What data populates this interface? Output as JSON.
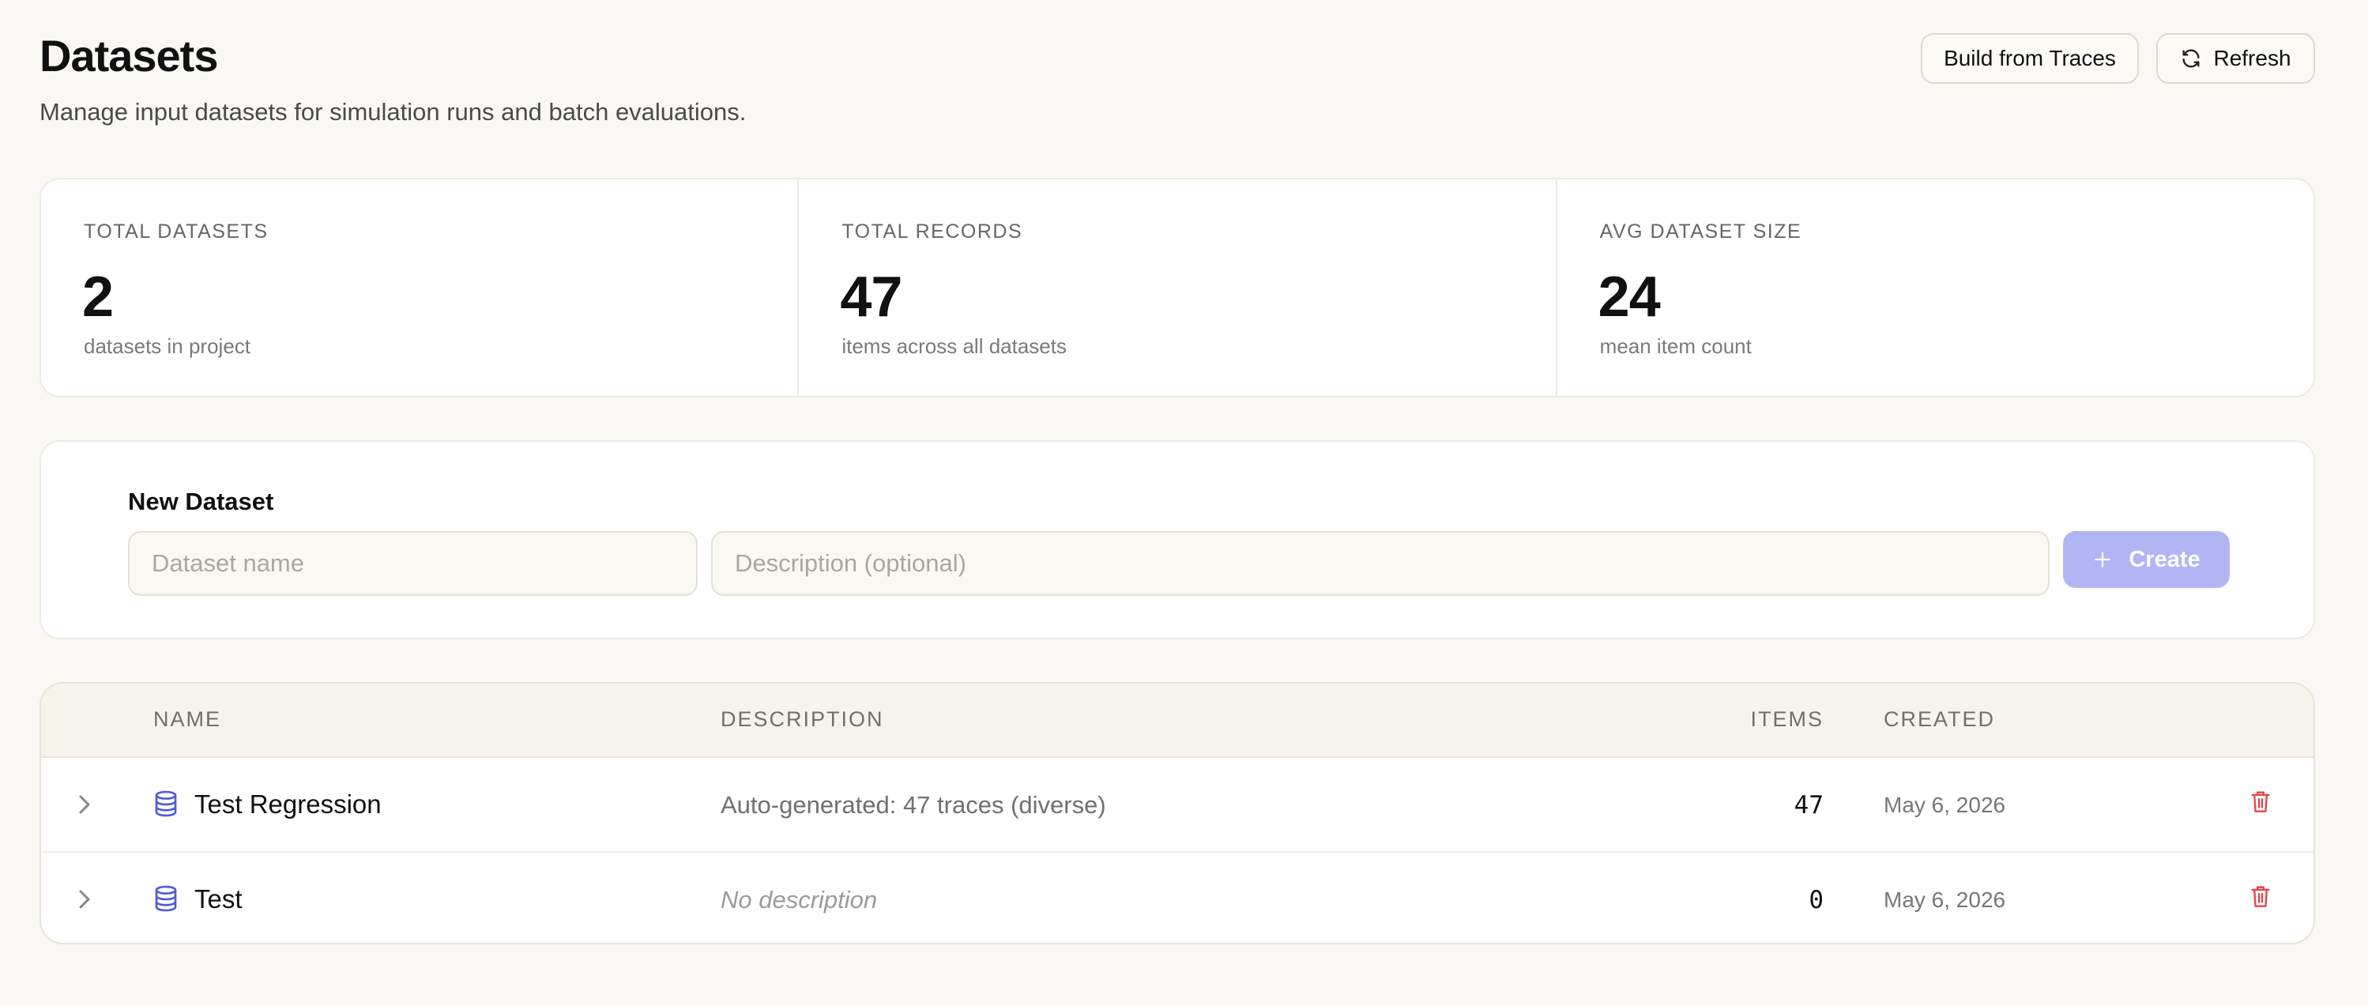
{
  "header": {
    "title": "Datasets",
    "subtitle": "Manage input datasets for simulation runs and batch evaluations.",
    "build_button": "Build from Traces",
    "refresh_button": "Refresh"
  },
  "stats": [
    {
      "label": "TOTAL DATASETS",
      "value": "2",
      "caption": "datasets in project"
    },
    {
      "label": "TOTAL RECORDS",
      "value": "47",
      "caption": "items across all datasets"
    },
    {
      "label": "AVG DATASET SIZE",
      "value": "24",
      "caption": "mean item count"
    }
  ],
  "new_dataset": {
    "title": "New Dataset",
    "name_placeholder": "Dataset name",
    "description_placeholder": "Description (optional)",
    "create_label": "Create"
  },
  "table": {
    "columns": {
      "name": "NAME",
      "description": "DESCRIPTION",
      "items": "ITEMS",
      "created": "CREATED"
    },
    "rows": [
      {
        "name": "Test Regression",
        "description": "Auto-generated: 47 traces (diverse)",
        "items": "47",
        "created": "May 6, 2026"
      },
      {
        "name": "Test",
        "description": "No description",
        "items": "0",
        "created": "May 6, 2026"
      }
    ]
  },
  "colors": {
    "accent": "#b1b5f4",
    "icon_blue": "#4f5bd5",
    "danger": "#e0454a",
    "background": "#f9f8f4"
  },
  "icons": [
    "refresh-icon",
    "plus-icon",
    "chevron-right-icon",
    "database-icon",
    "trash-icon"
  ]
}
